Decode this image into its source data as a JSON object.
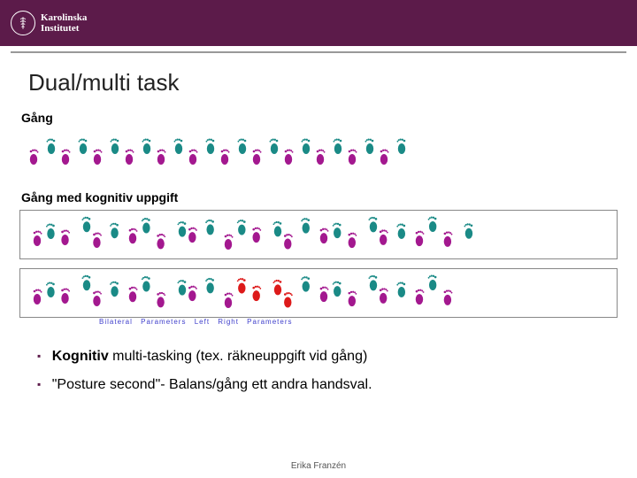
{
  "brand": {
    "name_line1": "Karolinska",
    "name_line2": "Institutet",
    "seal_glyph": "⚕"
  },
  "title": "Dual/multi task",
  "sections": {
    "gait_single": "Gång",
    "gait_dual": "Gång med kognitiv uppgift"
  },
  "legend": "Bilateral Parameters   Left   Right                           Parameters",
  "bullets": [
    {
      "strong": "Kognitiv",
      "rest": " multi-tasking (tex. räkneuppgift vid gång)"
    },
    {
      "strong": "",
      "rest": "\"Posture second\"- Balans/gång ett andra handsval."
    }
  ],
  "footer": "Erika Franzén",
  "chart_data": [
    {
      "type": "scatter",
      "title": "Gång (single task gait footprints)",
      "x": [
        0,
        1,
        2,
        3,
        4,
        5,
        6,
        7,
        8,
        9,
        10,
        11,
        12,
        13,
        14,
        15,
        16,
        17,
        18,
        19,
        20,
        21,
        22,
        23
      ],
      "y_offset": [
        0,
        1,
        0,
        1,
        0,
        1,
        0,
        1,
        0,
        1,
        0,
        1,
        0,
        1,
        0,
        1,
        0,
        1,
        0,
        1,
        0,
        1,
        0,
        1
      ],
      "series": [
        {
          "name": "Left foot",
          "color": "#a3188f"
        },
        {
          "name": "Right foot",
          "color": "#1a8a86"
        }
      ],
      "pattern": "regular alternating left/right, even spacing"
    },
    {
      "type": "scatter",
      "title": "Gång med kognitiv uppgift — trial 1",
      "x": [
        0,
        1,
        2,
        3,
        4,
        5,
        6,
        7,
        8,
        9,
        10,
        11,
        12,
        13,
        14,
        15,
        16,
        17,
        18,
        19,
        20,
        21,
        22,
        23,
        24,
        25,
        26,
        27
      ],
      "series": [
        {
          "name": "Left foot",
          "color": "#a3188f"
        },
        {
          "name": "Right foot",
          "color": "#1a8a86"
        }
      ],
      "pattern": "alternating, slightly denser and more variable spacing than single task"
    },
    {
      "type": "scatter",
      "title": "Gång med kognitiv uppgift — trial 2",
      "x": [
        0,
        1,
        2,
        3,
        4,
        5,
        6,
        7,
        8,
        9,
        10,
        11,
        12,
        13,
        14,
        15,
        16,
        17,
        18,
        19,
        20,
        21,
        22,
        23,
        24,
        25,
        26
      ],
      "series": [
        {
          "name": "Left foot",
          "color": "#a3188f"
        },
        {
          "name": "Right foot",
          "color": "#1a8a86"
        },
        {
          "name": "Flagged steps",
          "color": "#dd1a1a",
          "indices": [
            13,
            14,
            15,
            16
          ]
        }
      ],
      "pattern": "irregular, cluster of abnormal (red) steps mid-walk"
    }
  ]
}
